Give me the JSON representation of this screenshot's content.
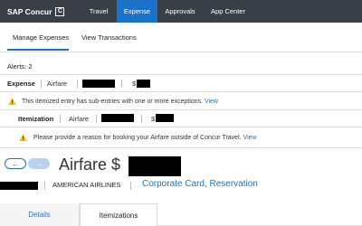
{
  "header": {
    "brand": "SAP Concur",
    "brand_mark": "C",
    "nav": [
      {
        "label": "Travel",
        "active": false
      },
      {
        "label": "Expense",
        "active": true
      },
      {
        "label": "Approvals",
        "active": false
      },
      {
        "label": "App Center",
        "active": false
      }
    ]
  },
  "subnav": {
    "tabs": [
      "Manage Expenses",
      "View Transactions"
    ]
  },
  "alerts": "Alerts: 2",
  "expense_row": {
    "label": "Expense",
    "type": "Airfare",
    "currency": "$"
  },
  "warning_1": {
    "text": "This itemized entry has sub-entries with one or more exceptions.",
    "link": "View"
  },
  "itemization_row": {
    "label": "Itemization",
    "type": "Airfare",
    "currency": "$"
  },
  "warning_2": {
    "text": "Please provide a reason for booking your Airfare outside of Concur Travel.",
    "link": "View"
  },
  "detail": {
    "prev_icon": "left-arrow",
    "next_icon": "right-arrow",
    "title": "Airfare $",
    "vendor": "AMERICAN AIRLINES",
    "payment": "Corporate Card, Reservation"
  },
  "tabs": [
    "Details",
    "Itemizations"
  ],
  "colors": {
    "nav_bg": "#3a3f47",
    "accent": "#1a73c8",
    "warning": "#f5c518"
  }
}
